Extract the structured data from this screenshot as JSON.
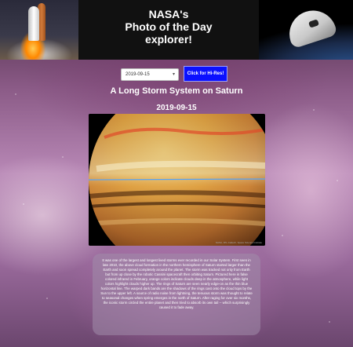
{
  "header": {
    "title_line1": "NASA's",
    "title_line2": "Photo of the Day",
    "title_line3": "explorer!"
  },
  "controls": {
    "date_value": "2019-09-15",
    "date_icon": "chevron-down-icon",
    "hires_label": "Click for Hi-Res!"
  },
  "photo": {
    "title": "A Long Storm System on Saturn",
    "date": "2019-09-15",
    "credit": "NASA, JPL-Caltech, Space Science Institute"
  },
  "description": {
    "text": "It was one of the largest and longest lived storms ever recorded in our Solar System. First seen in late 2010, the above cloud formation in the northern hemisphere of Saturn started larger than the Earth and soon spread completely around the planet. The storm was tracked not only from Earth but from up close by the robotic Cassini spacecraft then orbiting Saturn. Pictured here in false colored infrared in February, orange colors indicate clouds deep in the atmosphere, while light colors highlight clouds higher up. The rings of Saturn are seen nearly edge-on as the thin blue horizontal line. The warped dark bands are the shadows of the rings cast onto the cloud tops by the Sun to the upper left. A source of radio noise from lightning, the tenuous storm was thought to relate to seasonal changes when spring emerges in the north of Saturn. After raging for over six months, the iconic storm circled the entire planet and then tried to absorb its own tail -- which surprisingly caused it to fade away."
  },
  "colors": {
    "button_bg": "#0b10ff",
    "ring_line": "#4fa3ff"
  }
}
